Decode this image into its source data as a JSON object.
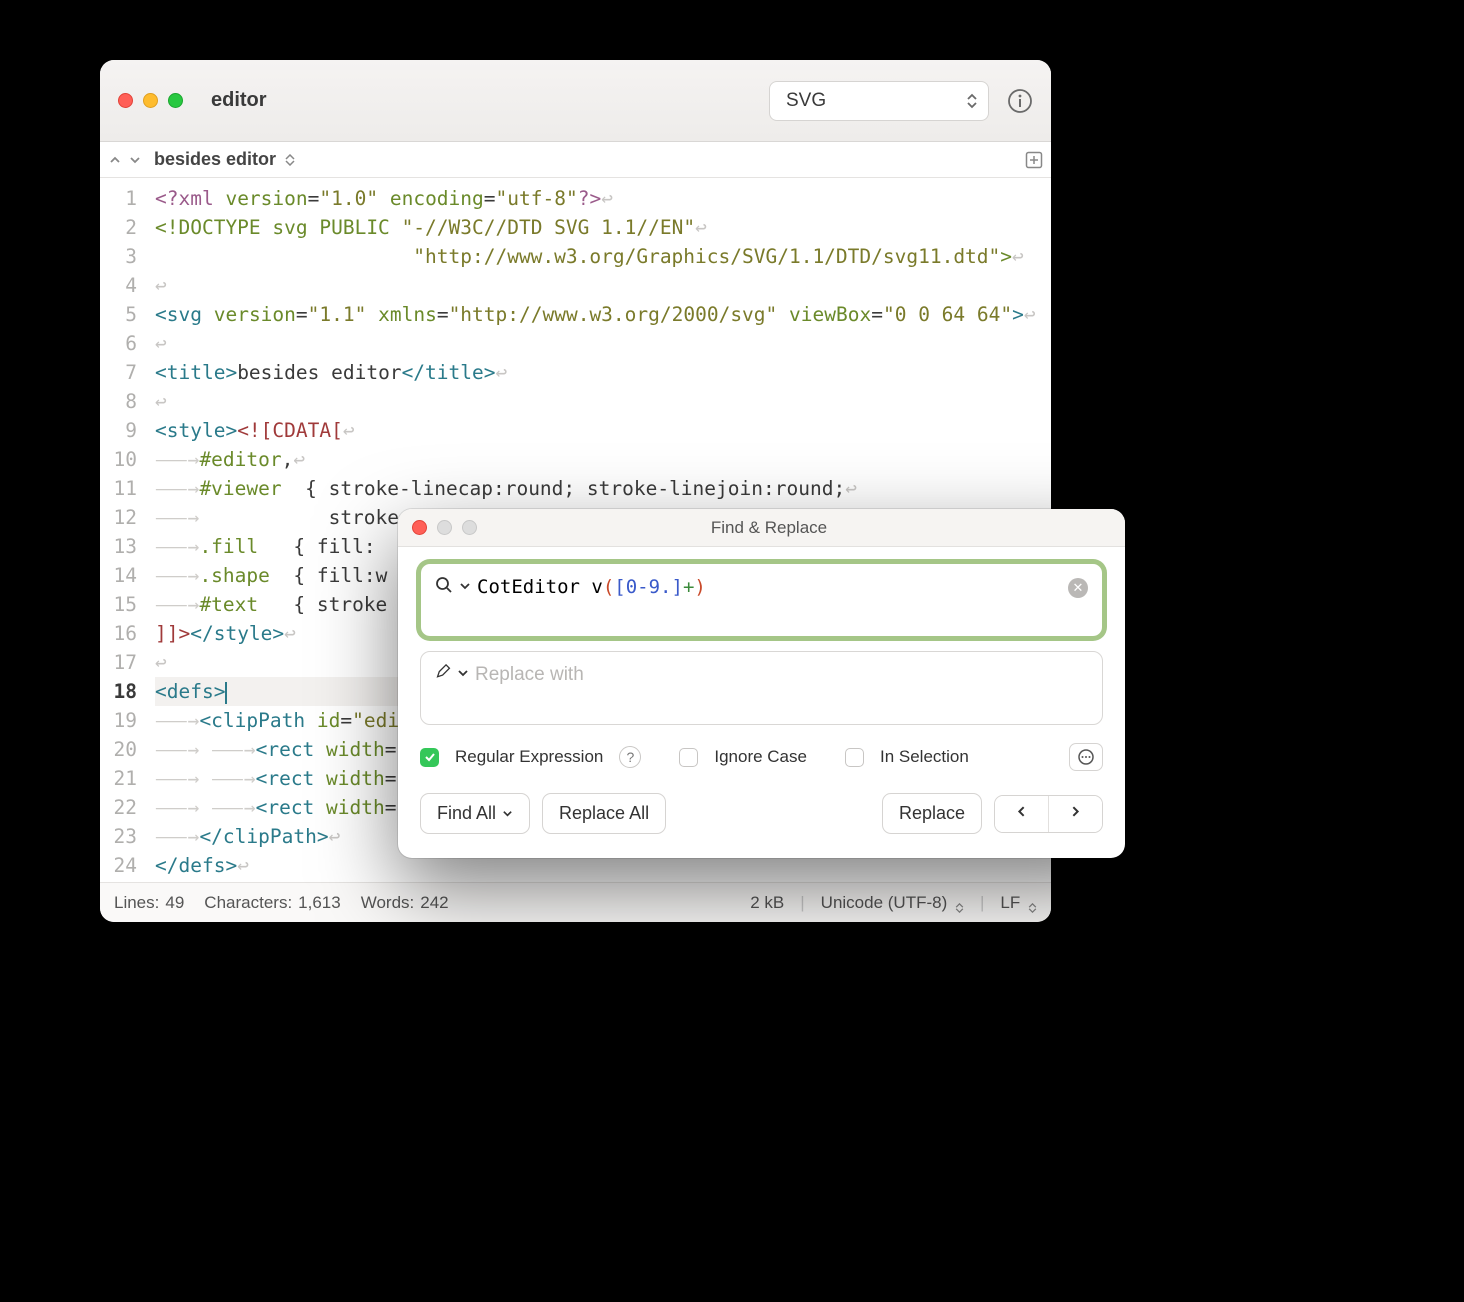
{
  "window": {
    "title": "editor",
    "syntax_mode": "SVG"
  },
  "pathbar": {
    "label": "besides editor"
  },
  "code": {
    "current_line": 18,
    "lines": [
      {
        "n": 1,
        "html": "<span class='pi'>&lt;?xml</span> <span class='attr'>version</span>=<span class='str'>\"1.0\"</span> <span class='attr'>encoding</span>=<span class='str'>\"utf-8\"</span><span class='pi'>?&gt;</span><span class='ret'>↩</span>"
      },
      {
        "n": 2,
        "html": "<span class='doctype'>&lt;!DOCTYPE svg PUBLIC</span> <span class='str'>\"-//W3C//DTD SVG 1.1//EN\"</span><span class='ret'>↩</span>"
      },
      {
        "n": 3,
        "html": "                      <span class='str'>\"http://www.w3.org/Graphics/SVG/1.1/DTD/svg11.dtd\"</span><span class='doctype'>&gt;</span><span class='ret'>↩</span>"
      },
      {
        "n": 4,
        "html": "<span class='ret'>↩</span>"
      },
      {
        "n": 5,
        "html": "<span class='tag'>&lt;svg</span> <span class='attr'>version</span>=<span class='str'>\"1.1\"</span> <span class='attr'>xmlns</span>=<span class='str'>\"http://www.w3.org/2000/svg\"</span> <span class='attr'>viewBox</span>=<span class='str'>\"0 0 64 64\"</span><span class='tag'>&gt;</span><span class='ret'>↩</span>"
      },
      {
        "n": 6,
        "html": "<span class='ret'>↩</span>"
      },
      {
        "n": 7,
        "html": "<span class='tag'>&lt;title&gt;</span>besides editor<span class='tag'>&lt;/title&gt;</span><span class='ret'>↩</span>"
      },
      {
        "n": 8,
        "html": "<span class='ret'>↩</span>"
      },
      {
        "n": 9,
        "html": "<span class='tag'>&lt;style&gt;</span><span class='cdata'>&lt;![CDATA[</span><span class='ret'>↩</span>"
      },
      {
        "n": 10,
        "html": "<span class='arrow-tab'>⸺→</span><span class='css-sel'>#editor</span>,<span class='ret'>↩</span>"
      },
      {
        "n": 11,
        "html": "<span class='arrow-tab'>⸺→</span><span class='css-sel'>#viewer</span>  { <span class='css-prop'>stroke-linecap</span>:round; <span class='css-prop'>stroke-linejoin</span>:round;<span class='ret'>↩</span>"
      },
      {
        "n": 12,
        "html": "<span class='arrow-tab'>⸺→</span>           <span class='css-prop'>stroke</span>"
      },
      {
        "n": 13,
        "html": "<span class='arrow-tab'>⸺→</span><span class='css-sel'>.fill</span>   { <span class='css-prop'>fill</span>:"
      },
      {
        "n": 14,
        "html": "<span class='arrow-tab'>⸺→</span><span class='css-sel'>.shape</span>  { <span class='css-prop'>fill</span>:w"
      },
      {
        "n": 15,
        "html": "<span class='arrow-tab'>⸺→</span><span class='css-sel'>#text</span>   { <span class='css-prop'>stroke</span>"
      },
      {
        "n": 16,
        "html": "<span class='cdata'>]]&gt;</span><span class='tag'>&lt;/style&gt;</span><span class='ret'>↩</span>"
      },
      {
        "n": 17,
        "html": "<span class='ret'>↩</span>"
      },
      {
        "n": 18,
        "html": "<span class='tag'>&lt;defs&gt;</span><span class='cursor'></span>"
      },
      {
        "n": 19,
        "html": "<span class='arrow-tab'>⸺→</span><span class='tag'>&lt;clipPath</span> <span class='attr'>id</span>=<span class='str'>\"edi</span>"
      },
      {
        "n": 20,
        "html": "<span class='arrow-tab'>⸺→ ⸺→</span><span class='tag'>&lt;rect</span> <span class='attr'>width</span>=<span class='str'>\"</span>"
      },
      {
        "n": 21,
        "html": "<span class='arrow-tab'>⸺→ ⸺→</span><span class='tag'>&lt;rect</span> <span class='attr'>width</span>=<span class='str'>\"</span>"
      },
      {
        "n": 22,
        "html": "<span class='arrow-tab'>⸺→ ⸺→</span><span class='tag'>&lt;rect</span> <span class='attr'>width</span>=<span class='str'>\"</span>"
      },
      {
        "n": 23,
        "html": "<span class='arrow-tab'>⸺→</span><span class='tag'>&lt;/clipPath&gt;</span><span class='ret'>↩</span>"
      },
      {
        "n": 24,
        "html": "<span class='tag'>&lt;/defs&gt;</span><span class='ret'>↩</span>"
      }
    ]
  },
  "statusbar": {
    "lines_label": "Lines:",
    "lines_value": "49",
    "chars_label": "Characters:",
    "chars_value": "1,613",
    "words_label": "Words:",
    "words_value": "242",
    "filesize": "2 kB",
    "encoding": "Unicode (UTF-8)",
    "line_endings": "LF"
  },
  "find": {
    "title": "Find & Replace",
    "search_value_plain": "CotEditor v",
    "search_regex_html": "<span class='rx-paren'>(</span><span class='rx-class'>[0-9.]</span><span class='rx-quant'>+</span><span class='rx-paren'>)</span>",
    "replace_placeholder": "Replace with",
    "opt_regex": "Regular Expression",
    "opt_ignorecase": "Ignore Case",
    "opt_inselection": "In Selection",
    "btn_findall": "Find All",
    "btn_replaceall": "Replace All",
    "btn_replace": "Replace"
  }
}
